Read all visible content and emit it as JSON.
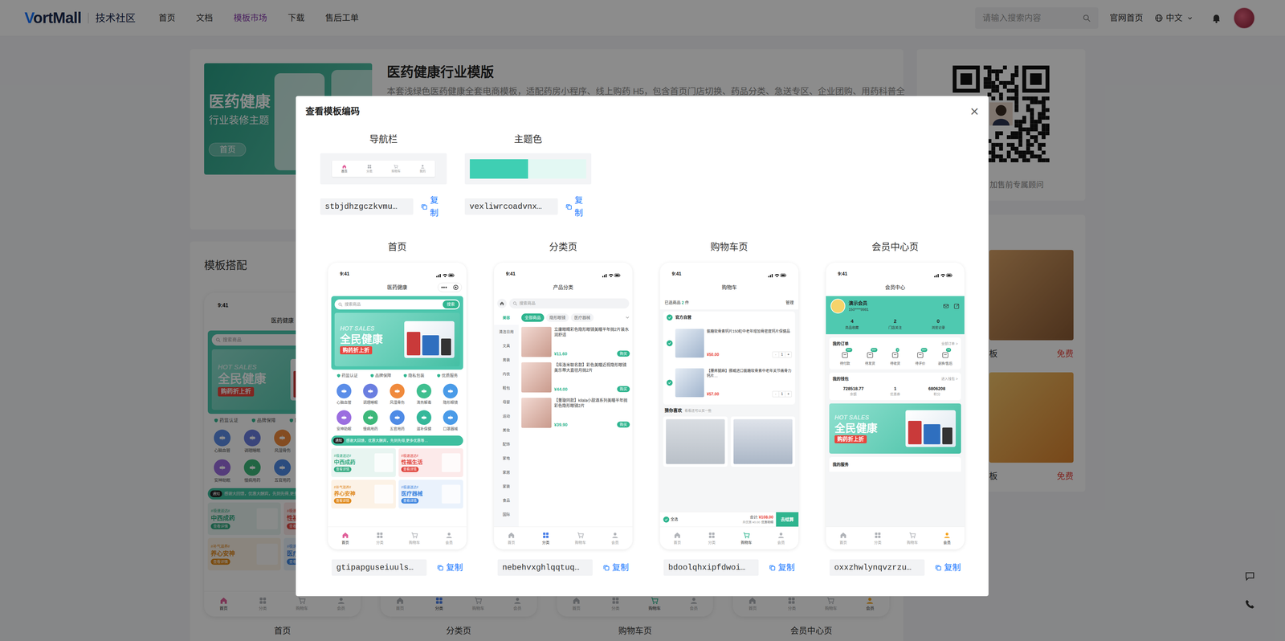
{
  "topnav": {
    "logo": "VortMall",
    "brand": "技术社区",
    "items": [
      {
        "label": "首页",
        "selected": false
      },
      {
        "label": "文档",
        "selected": false
      },
      {
        "label": "模板市场",
        "selected": true
      },
      {
        "label": "下载",
        "selected": false
      },
      {
        "label": "售后工单",
        "selected": false
      }
    ],
    "search": {
      "placeholder": "请输入搜索内容"
    },
    "home_link": "官网首页",
    "language": "中文"
  },
  "template": {
    "banner": {
      "title": "医药健康",
      "subtitle": "行业装修主题",
      "button": "首页"
    },
    "title": "医药健康行业模版",
    "description": "本套浅绿色医药健康全套电商模板，适配药房小程序、线上购药 H5，包含首页门店切换、药品分类、急送专区、企业团购、用药科普全"
  },
  "consult": {
    "text": "加售前专属顾问"
  },
  "matching": {
    "title": "模板搭配",
    "labels": [
      "首页",
      "分类页",
      "购物车页",
      "会员中心页"
    ]
  },
  "more_templates": [
    {
      "name": "板",
      "price": "免费"
    },
    {
      "name": "板",
      "price": "免费"
    }
  ],
  "modal": {
    "title": "查看模板编码",
    "close": "×",
    "copy": "复制",
    "navbar": {
      "label": "导航栏",
      "code": "stbjdhzgczkvmu…",
      "tabs": [
        {
          "label": "首页",
          "selected": true,
          "color": "#e0609a"
        },
        {
          "label": "分类",
          "selected": false,
          "color": "#4a7fe8"
        },
        {
          "label": "购物车",
          "selected": false,
          "color": "#2fb58f"
        },
        {
          "label": "我的",
          "selected": false,
          "color": "#f5a623"
        }
      ]
    },
    "theme": {
      "label": "主题色",
      "code": "vexliwrcoadvnx…",
      "swatches": [
        {
          "color": "#3fcfb3"
        },
        {
          "color": "#e3f8f3"
        }
      ]
    },
    "pages": [
      {
        "label": "首页",
        "code": "gtipapguseiuuls…",
        "screen": {
          "kind": "home",
          "time": "9:41",
          "title": "医药健康",
          "search": {
            "placeholder": "搜索商品",
            "button": "搜索"
          },
          "banner": {
            "tag": "HOT SALES",
            "title": "全民健康",
            "subtitle": "购药折上折"
          },
          "badges": [
            "药监认证",
            "品牌保障",
            "隐私包装",
            "优质服务"
          ],
          "categories": [
            {
              "label": "心脑血管",
              "color": "#5b8de8"
            },
            {
              "label": "调理睡眠",
              "color": "#6a7ee0"
            },
            {
              "label": "风湿骨伤",
              "color": "#f08a3c"
            },
            {
              "label": "清热解毒",
              "color": "#3fbf8f"
            },
            {
              "label": "隐形眼镜",
              "color": "#4a9be8"
            },
            {
              "label": "安神助眠",
              "color": "#9b6ee0"
            },
            {
              "label": "慢病用药",
              "color": "#3db87a"
            },
            {
              "label": "五官用药",
              "color": "#4f8be6"
            },
            {
              "label": "滋补保健",
              "color": "#35b89a"
            },
            {
              "label": "口罩器械",
              "color": "#4a9be8"
            }
          ],
          "notice": {
            "tag": "通知",
            "text": "感谢大回馈，优惠大酬宾，先到先得,更多优惠等…"
          },
          "promos": [
            {
              "tag": "#极速送达#",
              "title": "中西成药",
              "button": "查看详情",
              "color": "#2fa87e"
            },
            {
              "tag": "#极速送达#",
              "title": "性福生活",
              "button": "查看详情",
              "color": "#e0443c"
            },
            {
              "tag": "#补气滋养#",
              "title": "养心安神",
              "button": "查看详情",
              "color": "#e08a1c"
            },
            {
              "tag": "#极速送达#",
              "title": "医疗器械",
              "button": "查看详情",
              "color": "#3f86e0"
            }
          ],
          "tabs": [
            {
              "label": "首页",
              "selected": true,
              "color": "#e0609a"
            },
            {
              "label": "分类",
              "selected": false,
              "color": "#4a7fe8"
            },
            {
              "label": "购物车",
              "selected": false,
              "color": "#2fb58f"
            },
            {
              "label": "会员",
              "selected": false,
              "color": "#f5a623"
            }
          ]
        }
      },
      {
        "label": "分类页",
        "code": "nebehvxghlqqtuq…",
        "screen": {
          "kind": "category",
          "time": "9:41",
          "title": "产品分类",
          "search": {
            "placeholder": "搜索商品"
          },
          "sidebar": [
            {
              "label": "美容",
              "selected": true
            },
            {
              "label": "清洁日用",
              "selected": false
            },
            {
              "label": "文具",
              "selected": false
            },
            {
              "label": "男装",
              "selected": false
            },
            {
              "label": "内衣",
              "selected": false
            },
            {
              "label": "鞋包",
              "selected": false
            },
            {
              "label": "母婴",
              "selected": false
            },
            {
              "label": "运动",
              "selected": false
            },
            {
              "label": "美妆",
              "selected": false
            },
            {
              "label": "配饰",
              "selected": false
            },
            {
              "label": "家电",
              "selected": false
            },
            {
              "label": "家居",
              "selected": false
            },
            {
              "label": "家装",
              "selected": false
            },
            {
              "label": "食品",
              "selected": false
            },
            {
              "label": "国际",
              "selected": false
            }
          ],
          "chips": [
            {
              "label": "全部商品",
              "selected": true
            },
            {
              "label": "隐形眼镜",
              "selected": false
            },
            {
              "label": "医疗器械",
              "selected": false
            }
          ],
          "products": [
            {
              "name": "立康眼睛彩色隐形眼镜美瞳半年抛2片装水润舒适",
              "price": "¥11.60",
              "button": "购买"
            },
            {
              "name": "【库洛米联名款】彩色美瞳近视隐形眼镜美乐蒂大直径月抛2片",
              "price": "¥44.00",
              "button": "购买"
            },
            {
              "name": "【董璇同款】kilala小甜酒系列美瞳半年抛彩色隐形眼镜2片",
              "price": "¥39.90",
              "button": "购买"
            }
          ],
          "tabs": [
            {
              "label": "首页",
              "selected": false,
              "color": "#e0609a"
            },
            {
              "label": "分类",
              "selected": true,
              "color": "#4a7fe8"
            },
            {
              "label": "购物车",
              "selected": false,
              "color": "#2fb58f"
            },
            {
              "label": "会员",
              "selected": false,
              "color": "#f5a623"
            }
          ]
        }
      },
      {
        "label": "购物车页",
        "code": "bdoolqhxipfdwoi…",
        "screen": {
          "kind": "cart",
          "time": "9:41",
          "title": "购物车",
          "selected": {
            "label": "已选商品",
            "count": "2",
            "unit": "件"
          },
          "manage": "管理",
          "store": {
            "name": "官方自营",
            "checked": true
          },
          "items": [
            {
              "name": "氨糖软骨素钙片150粒中老年增加骨密度钙片保健品",
              "price": "¥50.00",
              "qty": "1",
              "checked": true
            },
            {
              "name": "【腰疼腿麻】挪威进口氨糖软骨素中老年关节痛骨力钙片…",
              "price": "¥57.00",
              "qty": "1",
              "checked": true
            }
          ],
          "stepper": {
            "minus": "-",
            "plus": "+"
          },
          "recommend": {
            "title": "猜你喜欢",
            "subtitle": "看看还可以买一些"
          },
          "footer": {
            "select_all": "全选",
            "select_all_checked": true,
            "total_label": "合计:",
            "total": "¥108.00",
            "discount": "共优惠 ¥0.00",
            "detail": "优惠明细",
            "checkout": "去结算"
          },
          "tabs": [
            {
              "label": "首页",
              "selected": false,
              "color": "#e0609a"
            },
            {
              "label": "分类",
              "selected": false,
              "color": "#4a7fe8"
            },
            {
              "label": "购物车",
              "selected": true,
              "color": "#2fb58f"
            },
            {
              "label": "会员",
              "selected": false,
              "color": "#f5a623"
            }
          ]
        }
      },
      {
        "label": "会员中心页",
        "code": "oxxzhwlynqvzrzu…",
        "screen": {
          "kind": "member",
          "time": "9:41",
          "title": "会员中心",
          "user": {
            "name": "演示会员",
            "phone": "150****9981"
          },
          "stats": [
            {
              "value": "4",
              "label": "商品收藏"
            },
            {
              "value": "2",
              "label": "门店关注"
            },
            {
              "value": "0",
              "label": "浏览记录"
            }
          ],
          "orders": {
            "title": "我的订单",
            "link": "全部订单 >",
            "items": [
              {
                "label": "待付款",
                "badge": "99+"
              },
              {
                "label": "待发货",
                "badge": "99+"
              },
              {
                "label": "待收货",
                "badge": "3"
              },
              {
                "label": "待评价",
                "badge": "99+"
              },
              {
                "label": "退换/售后",
                "badge": "74"
              }
            ]
          },
          "wallet": {
            "title": "我的钱包",
            "link": "进入钱包 >",
            "items": [
              {
                "value": "728518.77",
                "label": "余额"
              },
              {
                "value": "1",
                "label": "优惠券"
              },
              {
                "value": "6806208",
                "label": "积分"
              }
            ]
          },
          "banner": {
            "tag": "HOT SALES",
            "title": "全民健康",
            "subtitle": "购药折上折"
          },
          "services": {
            "title": "我的服务"
          },
          "tabs": [
            {
              "label": "首页",
              "selected": false,
              "color": "#e0609a"
            },
            {
              "label": "分类",
              "selected": false,
              "color": "#4a7fe8"
            },
            {
              "label": "购物车",
              "selected": false,
              "color": "#2fb58f"
            },
            {
              "label": "会员",
              "selected": true,
              "color": "#f5a623"
            }
          ]
        }
      }
    ]
  }
}
